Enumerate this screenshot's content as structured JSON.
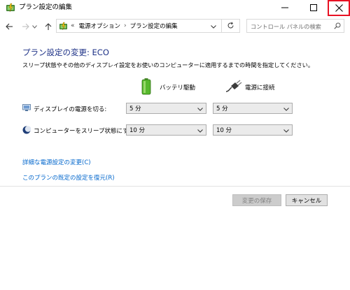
{
  "window": {
    "title": "プラン設定の編集",
    "controls": {
      "minimize": "minimize",
      "maximize": "maximize",
      "close": "close"
    }
  },
  "address": {
    "overflow": "«",
    "crumbs": [
      "電源オプション",
      "プラン設定の編集"
    ],
    "separator": "›",
    "search_placeholder": "コントロール パネルの検索"
  },
  "main": {
    "heading": "プラン設定の変更: ECO",
    "description": "スリープ状態やその他のディスプレイ設定をお使いのコンピューターに適用するまでの時間を指定してください。",
    "columns": {
      "battery": "バッテリ駆動",
      "plugged": "電源に接続"
    },
    "rows": [
      {
        "label": "ディスプレイの電源を切る:",
        "battery_value": "5 分",
        "plugged_value": "5 分"
      },
      {
        "label": "コンピューターをスリープ状態にする:",
        "battery_value": "10 分",
        "plugged_value": "10 分"
      }
    ],
    "links": {
      "advanced": "詳細な電源設定の変更(C)",
      "restore": "このプランの既定の設定を復元(R)"
    },
    "buttons": {
      "save": "変更の保存",
      "cancel": "キャンセル"
    }
  }
}
